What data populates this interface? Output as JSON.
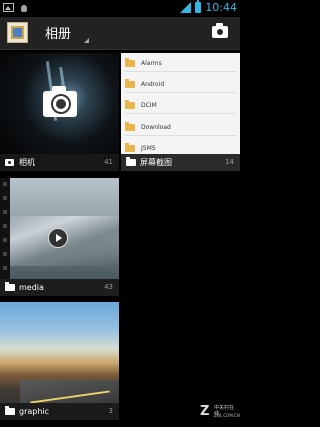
{
  "status_bar": {
    "time": "10:44",
    "left_icons": [
      "image-notification-icon",
      "bug-notification-icon"
    ],
    "right_icons": [
      "signal-icon",
      "battery-icon"
    ],
    "accent_color": "#33b5e5"
  },
  "action_bar": {
    "title": "相册",
    "app_icon": "gallery-app-icon",
    "camera_button": "camera-icon"
  },
  "albums": [
    {
      "name": "相机",
      "count": "41",
      "type_icon": "camera-icon"
    },
    {
      "name": "屏幕截图",
      "count": "14",
      "type_icon": "folder-icon",
      "preview_items": [
        "Alarms",
        "Android",
        "DCIM",
        "Download",
        "JSMS"
      ]
    },
    {
      "name": "media",
      "count": "43",
      "type_icon": "folder-icon",
      "overlay_icon": "play-icon"
    },
    {
      "name": "graphic",
      "count": "3",
      "type_icon": "folder-icon"
    }
  ],
  "watermark": {
    "logo": "Z",
    "text": "中关村在线",
    "url": "ZOL.COM.CN"
  }
}
